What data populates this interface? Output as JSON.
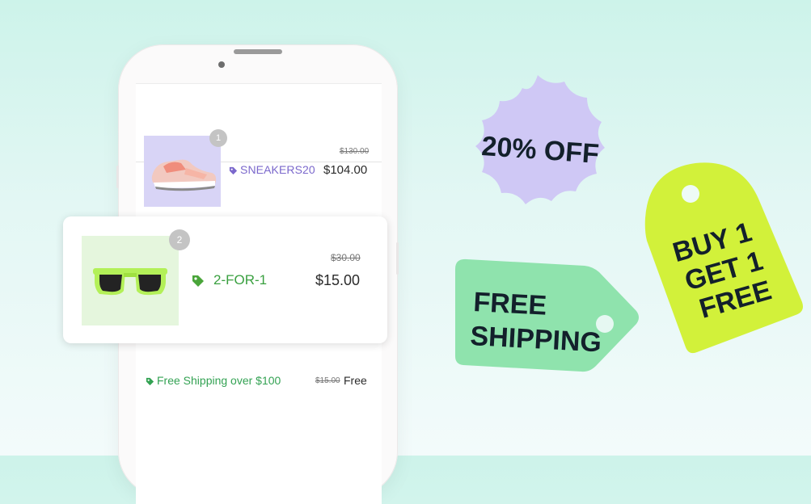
{
  "cart": {
    "items": [
      {
        "index": "1",
        "product_icon": "sneaker-icon",
        "promo_code": "SNEAKERS20",
        "original_price": "$130.00",
        "price": "$104.00"
      },
      {
        "index": "2",
        "product_icon": "sunglasses-icon",
        "promo_code": "2-FOR-1",
        "original_price": "$30.00",
        "price": "$15.00"
      }
    ],
    "shipping": {
      "label": "Free Shipping over $100",
      "original_price": "$15.00",
      "price": "Free"
    }
  },
  "stickers": {
    "discount": "20% OFF",
    "shipping_line1": "FREE",
    "shipping_line2": "SHIPPING",
    "bogo_line1": "BUY 1",
    "bogo_line2": "GET 1",
    "bogo_line3": "FREE"
  },
  "colors": {
    "purple_accent": "#7b68cc",
    "green_accent": "#3aa040",
    "sticker_lavender": "#cfc8f5",
    "sticker_mint": "#8fe3ad",
    "sticker_lime": "#d2f13a"
  }
}
